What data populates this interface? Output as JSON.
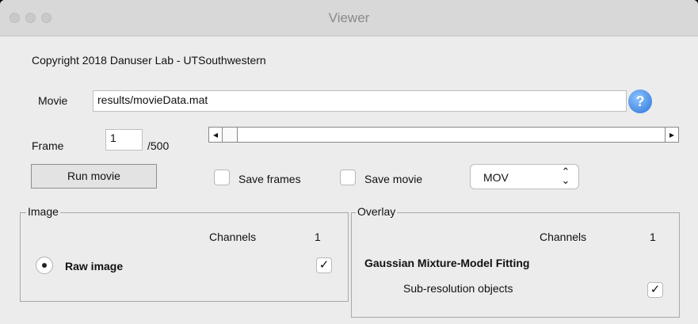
{
  "window": {
    "title": "Viewer"
  },
  "copyright": "Copyright 2018 Danuser Lab - UTSouthwestern",
  "movie": {
    "label": "Movie",
    "path": "results/movieData.mat",
    "help_icon_text": "?"
  },
  "frame": {
    "label": "Frame",
    "value": "1",
    "total": "/500",
    "slider_left_arrow": "◂",
    "slider_right_arrow": "▸",
    "slider_level": 0.0
  },
  "controls": {
    "run_movie": "Run movie",
    "save_frames": "Save frames",
    "save_movie": "Save movie",
    "format_selected": "MOV",
    "format_arrows": "⌃⌄"
  },
  "image_panel": {
    "title": "Image",
    "channels_label": "Channels",
    "channels_value": "1",
    "raw_image_label": "Raw image",
    "checkmark": "✓"
  },
  "overlay_panel": {
    "title": "Overlay",
    "channels_label": "Channels",
    "channels_value": "1",
    "section_title": "Gaussian Mixture-Model Fitting",
    "subresolution_label": "Sub-resolution objects",
    "checkmark": "✓"
  }
}
